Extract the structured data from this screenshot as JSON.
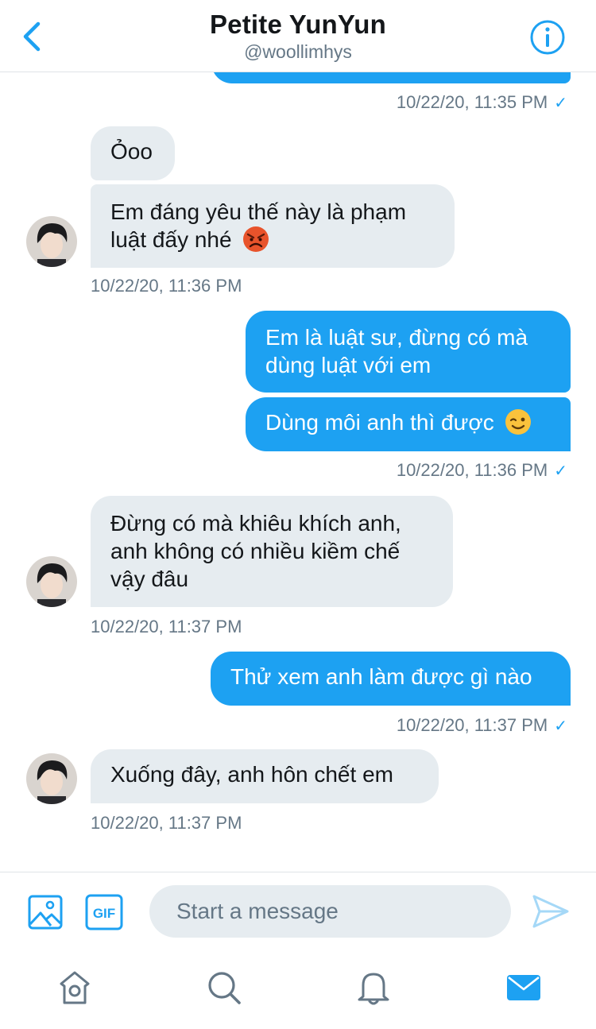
{
  "header": {
    "title": "Petite YunYun",
    "handle": "@woollimhys"
  },
  "messages": [
    {
      "direction": "out",
      "text": "",
      "timestamp": "10/22/20, 11:35 PM",
      "read": true
    },
    {
      "direction": "in",
      "text": "Ỏoo"
    },
    {
      "direction": "in",
      "text": "Em đáng yêu thế này là phạm luật đấy nhé",
      "emoji": "angry-face",
      "timestamp": "10/22/20, 11:36 PM"
    },
    {
      "direction": "out",
      "text": "Em là luật sư, đừng có mà dùng luật với em"
    },
    {
      "direction": "out",
      "text": "Dùng môi anh thì được",
      "emoji": "winking-face",
      "timestamp": "10/22/20, 11:36 PM",
      "read": true
    },
    {
      "direction": "in",
      "text": "Đừng có mà khiêu khích anh, anh không có nhiều kiềm chế vậy đâu",
      "timestamp": "10/22/20, 11:37 PM"
    },
    {
      "direction": "out",
      "text": "Thử xem anh làm được gì nào",
      "timestamp": "10/22/20, 11:37 PM",
      "read": true
    },
    {
      "direction": "in",
      "text": "Xuống đây, anh hôn chết em",
      "timestamp": "10/22/20, 11:37 PM"
    }
  ],
  "composer": {
    "placeholder": "Start a message",
    "gif_label": "GIF"
  },
  "tabs": [
    "home",
    "explore",
    "notifications",
    "messages"
  ],
  "active_tab": "messages",
  "colors": {
    "accent": "#1da1f2",
    "incoming_bubble": "#e6ecf0",
    "secondary_text": "#657786"
  }
}
